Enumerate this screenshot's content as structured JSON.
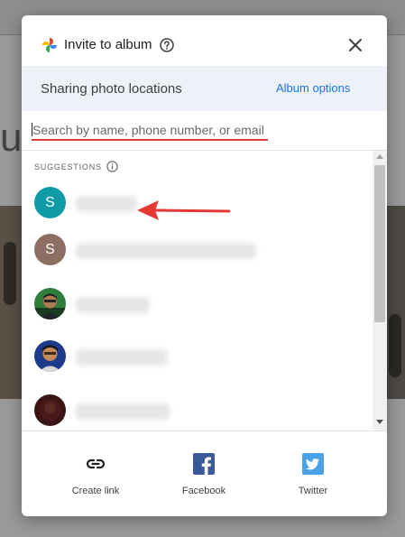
{
  "dialog": {
    "title": "Invite to album",
    "sharing_label": "Sharing photo locations",
    "album_options_label": "Album options",
    "close_icon": "close-icon"
  },
  "search": {
    "value": "",
    "placeholder": "Search by name, phone number, or email"
  },
  "suggestions": {
    "heading": "SUGGESTIONS",
    "items": [
      {
        "avatar_type": "initial",
        "initial": "S",
        "avatar_color": "#0f9aa8"
      },
      {
        "avatar_type": "initial",
        "initial": "S",
        "avatar_color": "#8d6e63"
      },
      {
        "avatar_type": "photo"
      },
      {
        "avatar_type": "photo"
      },
      {
        "avatar_type": "photo"
      }
    ]
  },
  "share_options": [
    {
      "label": "Create link",
      "icon": "link-icon"
    },
    {
      "label": "Facebook",
      "icon": "facebook-icon"
    },
    {
      "label": "Twitter",
      "icon": "twitter-icon"
    }
  ],
  "colors": {
    "accent": "#1a73e8",
    "annotation": "#e53935",
    "facebook": "#3b5998",
    "twitter": "#4aa1e6"
  }
}
